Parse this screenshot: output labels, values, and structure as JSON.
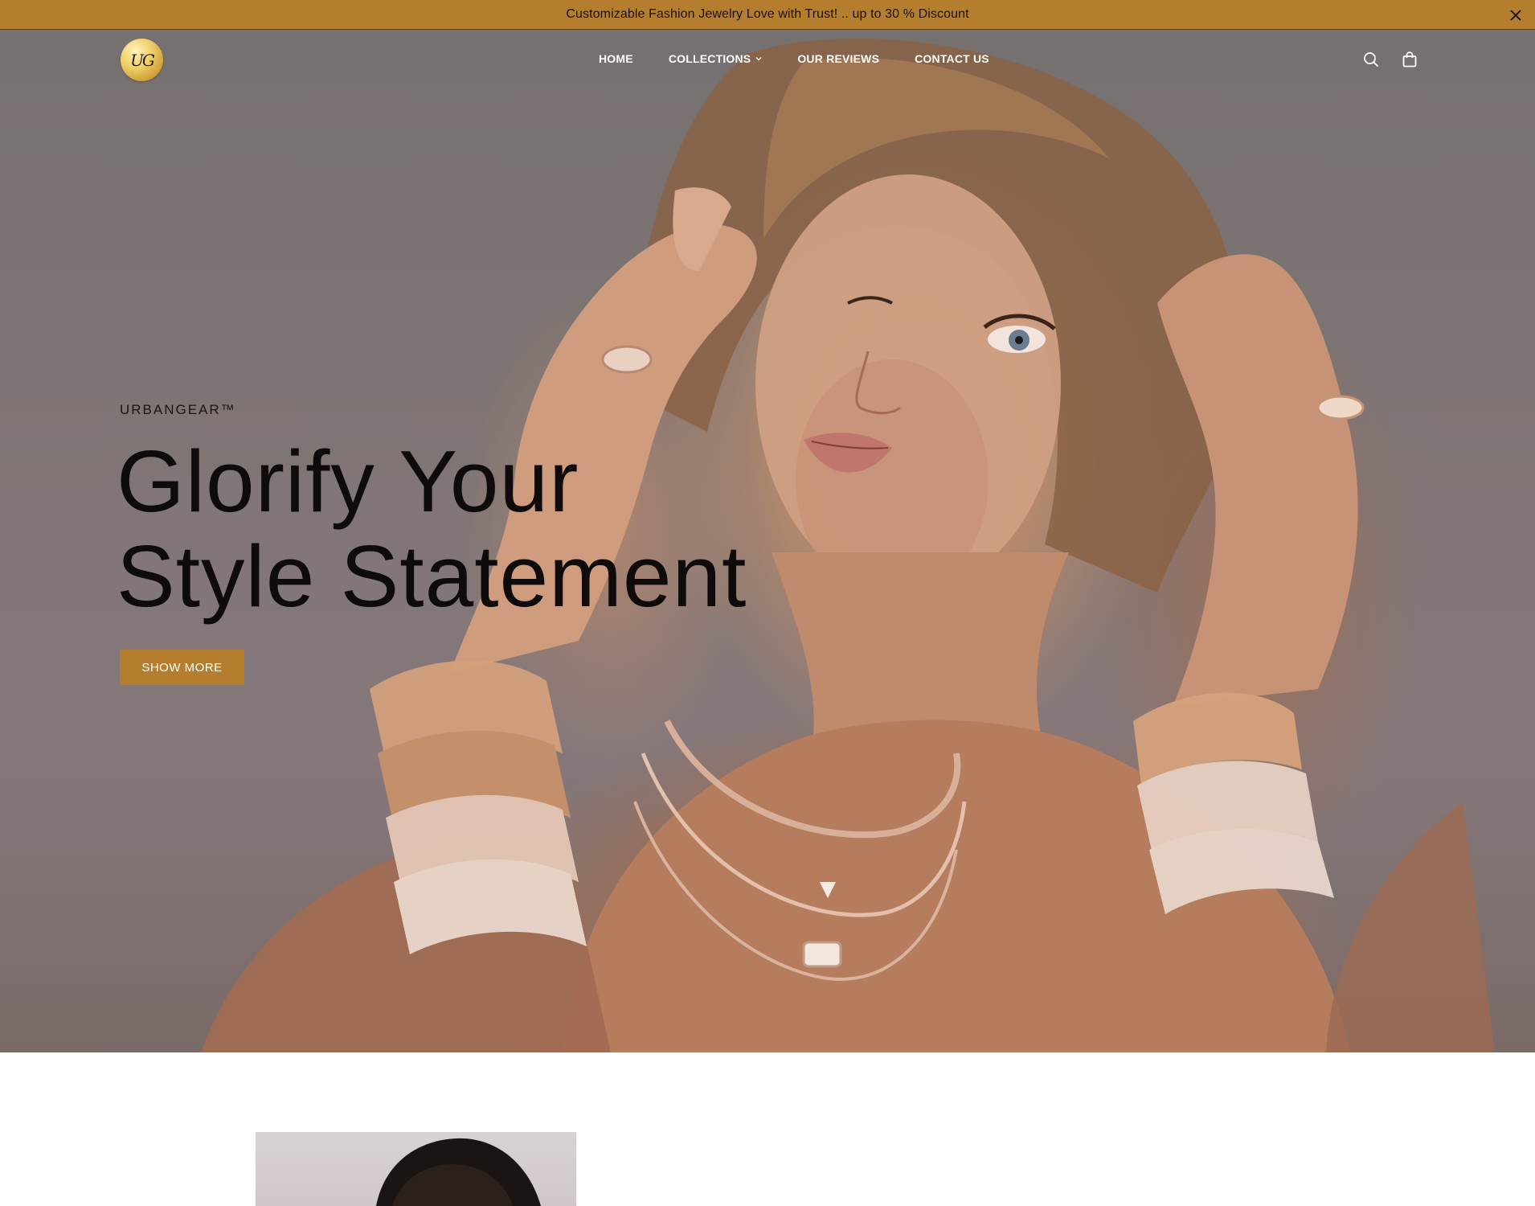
{
  "announcement": {
    "text": "Customizable Fashion Jewelry Love with Trust! .. up to 30 % Discount"
  },
  "brand": {
    "logo_text": "UG"
  },
  "nav": {
    "items": [
      {
        "label": "HOME"
      },
      {
        "label": "COLLECTIONS"
      },
      {
        "label": "OUR REVIEWS"
      },
      {
        "label": "CONTACT US"
      }
    ]
  },
  "header_icons": {
    "search": "search-icon",
    "cart": "shopping-bag-icon"
  },
  "hero": {
    "eyebrow": "URBANGEAR™",
    "headline_line1": "Glorify Your",
    "headline_line2": "Style Statement",
    "cta_label": "SHOW MORE"
  },
  "colors": {
    "accent": "#b57e2e",
    "announcement_bg": "#b57e2e",
    "headline": "#0e0b0a"
  }
}
